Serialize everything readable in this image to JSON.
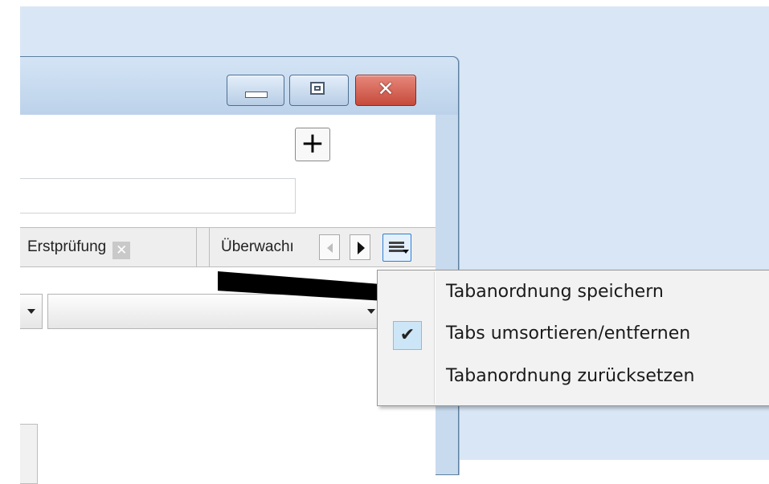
{
  "window": {
    "titlebar_buttons": {
      "minimize": "minimize-icon",
      "maximize": "maximize-icon",
      "close_glyph": "✕",
      "close_color": "#c64a3a"
    },
    "toolbar": {
      "add_label": "+"
    }
  },
  "tabs": {
    "items": [
      {
        "label": "Erstprüfung",
        "close_glyph": "✕"
      },
      {
        "label": "Überwachı"
      }
    ],
    "scroll_left_icon": "triangle-left-icon",
    "scroll_right_icon": "triangle-right-icon",
    "menu_icon": "hamburger-dropdown-icon",
    "menu_button_accent": "#2f7fd3"
  },
  "context_menu": {
    "items": [
      {
        "label": "Tabanordnung speichern",
        "checked": false
      },
      {
        "label": "Tabs umsortieren/entfernen",
        "checked": true,
        "check_glyph": "✔"
      },
      {
        "label": "Tabanordnung zurücksetzen",
        "checked": false
      }
    ],
    "check_highlight": "#cde6f7"
  },
  "annotation": {
    "arrow_icon": "arrow-right-icon",
    "color": "#000000"
  }
}
